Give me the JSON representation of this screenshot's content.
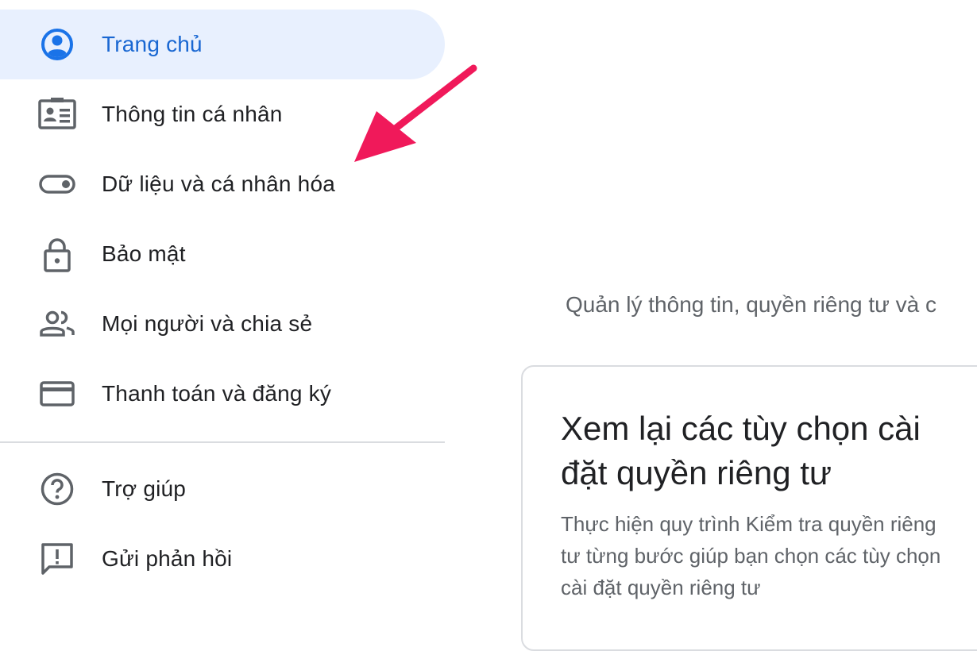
{
  "sidebar": {
    "items": [
      {
        "label": "Trang chủ",
        "icon": "account-circle-icon",
        "active": true
      },
      {
        "label": "Thông tin cá nhân",
        "icon": "id-card-icon"
      },
      {
        "label": "Dữ liệu và cá nhân hóa",
        "icon": "toggle-icon"
      },
      {
        "label": "Bảo mật",
        "icon": "lock-icon"
      },
      {
        "label": "Mọi người và chia sẻ",
        "icon": "people-icon"
      },
      {
        "label": "Thanh toán và đăng ký",
        "icon": "credit-card-icon"
      }
    ],
    "secondary": [
      {
        "label": "Trợ giúp",
        "icon": "help-icon"
      },
      {
        "label": "Gửi phản hồi",
        "icon": "feedback-icon"
      }
    ]
  },
  "main": {
    "subtitle": "Quản lý thông tin, quyền riêng tư và c",
    "card": {
      "title": "Xem lại các tùy chọn cài đặt quyền riêng tư",
      "description": "Thực hiện quy trình Kiểm tra quyền riêng tư từng bước giúp bạn chọn các tùy chọn cài đặt quyền riêng tư"
    }
  },
  "colors": {
    "accent": "#1a73e8",
    "active_bg": "#e8f0fe",
    "annotation_arrow": "#f0195a"
  }
}
